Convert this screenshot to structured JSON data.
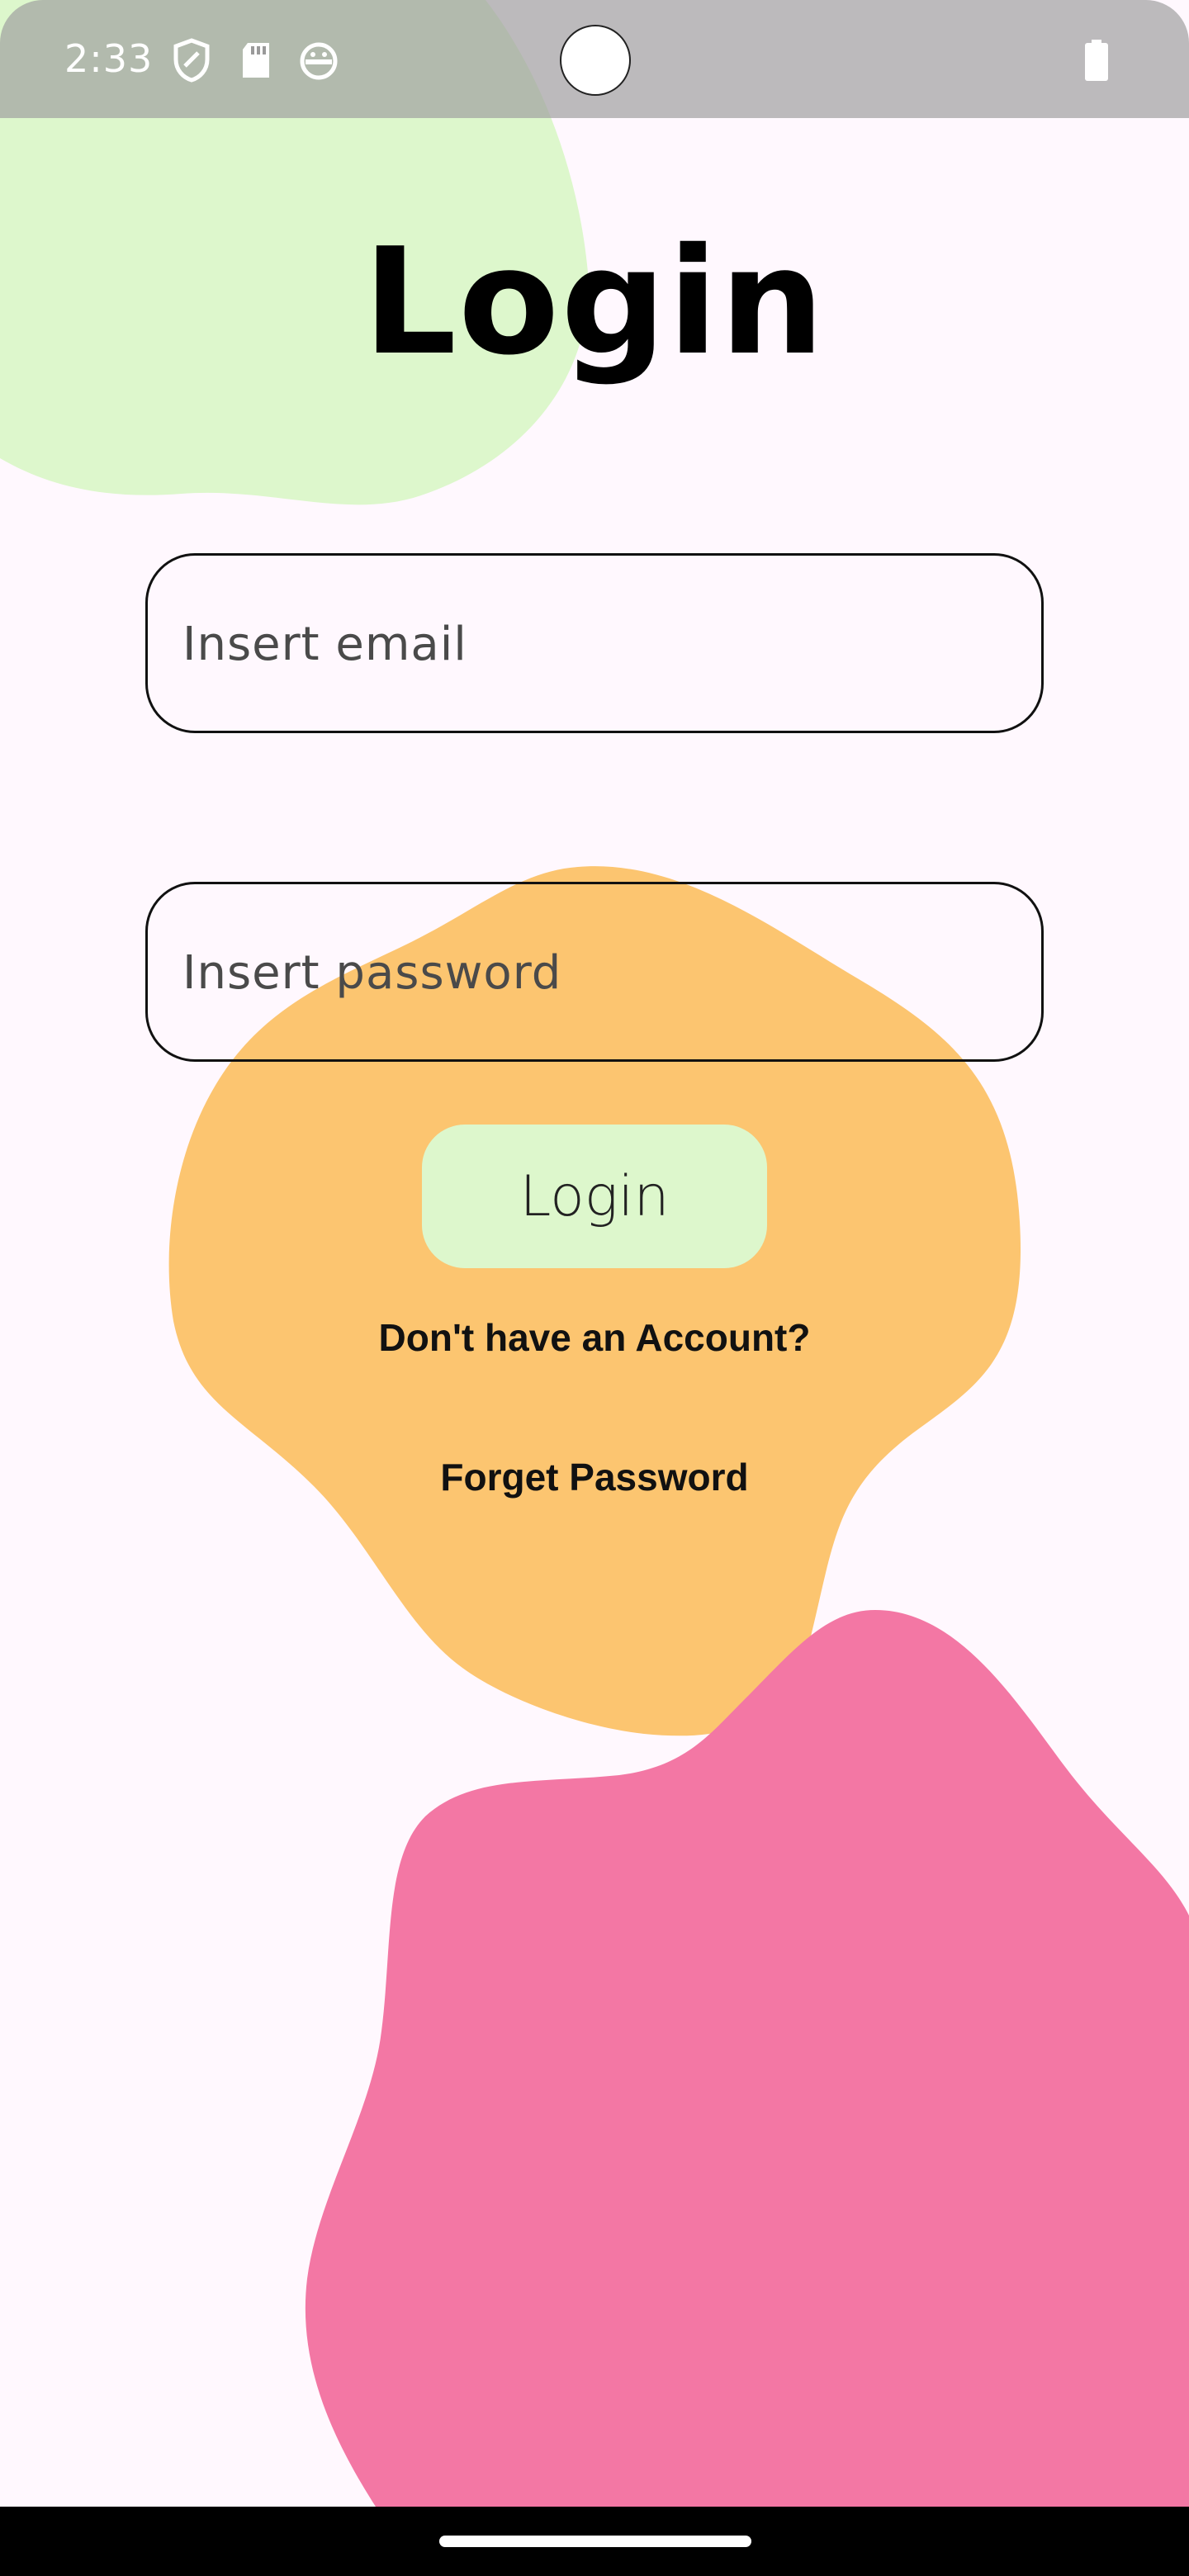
{
  "status_bar": {
    "time": "2:33",
    "icons": [
      "shield-icon",
      "sd-card-icon",
      "android-face-icon",
      "battery-icon"
    ]
  },
  "page": {
    "title": "Login"
  },
  "form": {
    "email_placeholder": "Insert email",
    "password_placeholder": "Insert password",
    "login_button_label": "Login"
  },
  "links": {
    "signup_label": "Don't have an Account?",
    "forgot_label": "Forget Password"
  },
  "colors": {
    "background": "#FFF8FE",
    "blob_green": "#DDF7CC",
    "blob_orange": "#FCC570",
    "blob_pink": "#F377A4",
    "login_button": "#DDF7CC"
  }
}
